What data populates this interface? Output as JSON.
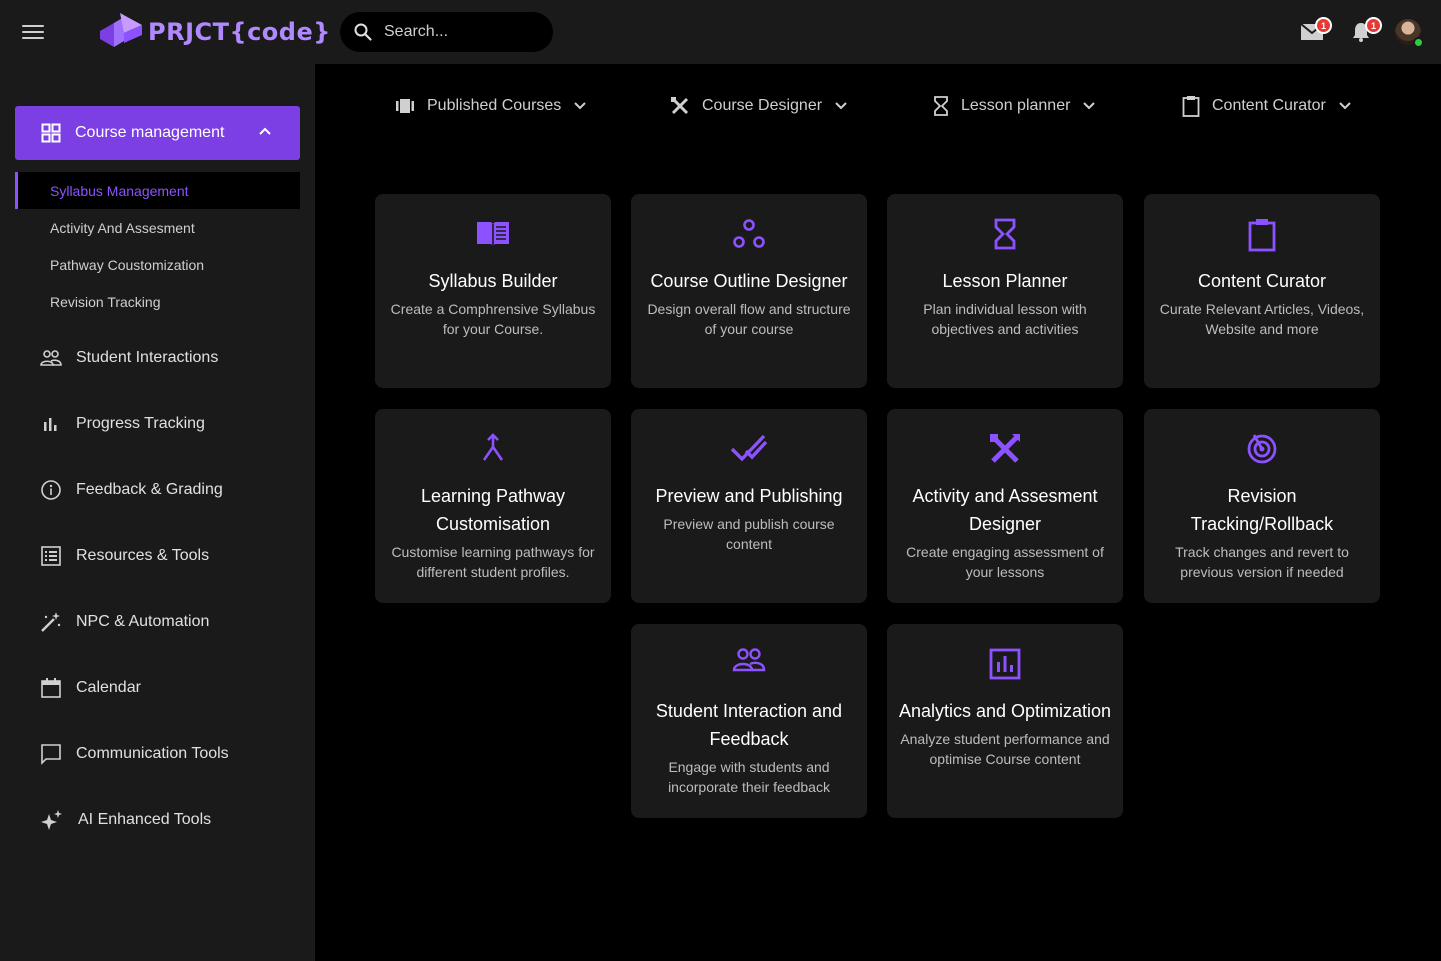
{
  "app": {
    "brand": "PRJCT{code}"
  },
  "header": {
    "search_placeholder": "Search...",
    "mail_badge": "1",
    "bell_badge": "1"
  },
  "sidebar": {
    "active_section": "Course management",
    "sub_items": [
      {
        "label": "Syllabus Management",
        "active": true
      },
      {
        "label": "Activity And Assesment"
      },
      {
        "label": "Pathway Coustomization"
      },
      {
        "label": "Revision Tracking"
      }
    ],
    "items": [
      {
        "label": "Student Interactions",
        "icon": "people-icon"
      },
      {
        "label": "Progress Tracking",
        "icon": "bar-chart-icon"
      },
      {
        "label": "Feedback & Grading",
        "icon": "info-icon"
      },
      {
        "label": "Resources & Tools",
        "icon": "list-icon"
      },
      {
        "label": "NPC & Automation",
        "icon": "magic-wand-icon"
      },
      {
        "label": "Calendar",
        "icon": "calendar-icon"
      },
      {
        "label": "Communication Tools",
        "icon": "chat-icon"
      },
      {
        "label": "AI Enhanced Tools",
        "icon": "sparkle-icon"
      }
    ]
  },
  "tabs": [
    {
      "label": "Published Courses",
      "icon": "slides-icon"
    },
    {
      "label": "Course Designer",
      "icon": "design-tools-icon"
    },
    {
      "label": "Lesson planner",
      "icon": "hourglass-icon"
    },
    {
      "label": "Content Curator",
      "icon": "clipboard-icon"
    }
  ],
  "cards": [
    {
      "title": "Syllabus Builder",
      "desc": "Create a Comphrensive Syllabus for your Course.",
      "icon": "book-icon"
    },
    {
      "title": "Course Outline Designer",
      "desc": "Design overall flow and structure of your course",
      "icon": "workflow-icon"
    },
    {
      "title": "Lesson Planner",
      "desc": "Plan individual lesson with objectives and activities",
      "icon": "hourglass-icon"
    },
    {
      "title": "Content Curator",
      "desc": "Curate Relevant Articles, Videos, Website and more",
      "icon": "clipboard-icon"
    },
    {
      "title": "Learning Pathway Customisation",
      "desc": "Customise learning pathways for different student profiles.",
      "icon": "merge-icon"
    },
    {
      "title": "Preview and Publishing",
      "desc": "Preview and publish course content",
      "icon": "double-check-icon"
    },
    {
      "title": "Activity and Assesment Designer",
      "desc": "Create engaging assessment of your lessons",
      "icon": "design-tools-icon"
    },
    {
      "title": "Revision Tracking/Rollback",
      "desc": "Track changes and revert to previous version if needed",
      "icon": "target-icon"
    },
    {
      "title": "Student Interaction and Feedback",
      "desc": "Engage with students and incorporate their feedback",
      "icon": "people-icon"
    },
    {
      "title": "Analytics and Optimization",
      "desc": "Analyze student performance and optimise Course content",
      "icon": "analytics-icon"
    }
  ],
  "colors": {
    "accent": "#8c52ff",
    "active_nav": "#7b3fe4",
    "panel": "#1a1a1a",
    "background": "#000000"
  }
}
